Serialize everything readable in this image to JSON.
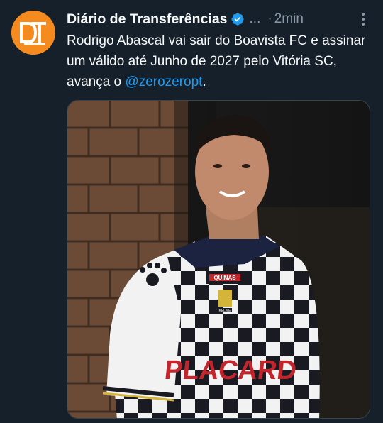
{
  "author": {
    "display_name": "Diário de Transferências",
    "handle": "...",
    "separator": "·",
    "time": "2min",
    "avatar_icon": "dt-logo",
    "avatar_color": "#f58a1f",
    "verified_color": "#1d9bf0"
  },
  "tweet": {
    "text_before": "Rodrigo Abascal vai sair do Boavista FC e assinar um válido até Junho de 2027 pelo Vitória SC, avança o ",
    "mention": "@zerozeropt",
    "text_after": "."
  },
  "media": {
    "jersey_sponsor": "PLACARD",
    "jersey_patch": "QUINAS",
    "jersey_brand": "KELME"
  },
  "colors": {
    "background": "#15202b",
    "text": "#f7f9f9",
    "secondary_text": "#8b98a5",
    "link": "#1d9bf0"
  }
}
